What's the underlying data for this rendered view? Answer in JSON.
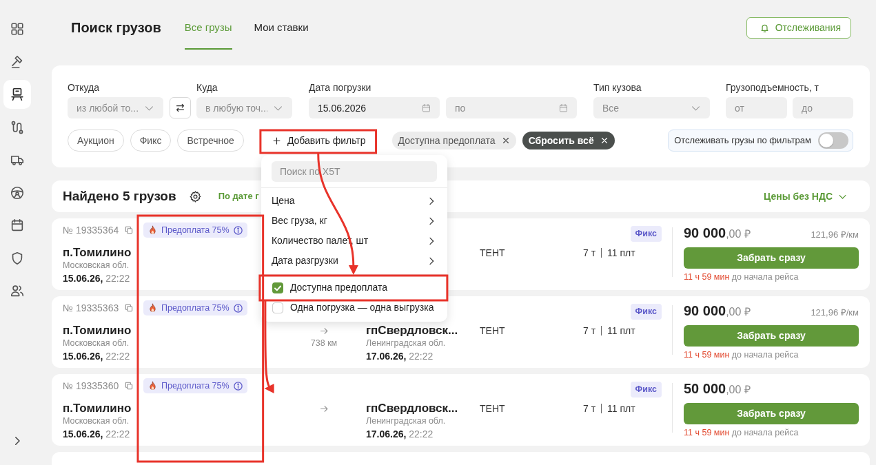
{
  "sidebar": {
    "items": [
      {
        "selected": false
      },
      {
        "selected": false
      },
      {
        "selected": true
      },
      {
        "selected": false
      },
      {
        "selected": false
      },
      {
        "selected": false
      },
      {
        "selected": false
      },
      {
        "selected": false
      },
      {
        "selected": false
      }
    ]
  },
  "header": {
    "title": "Поиск грузов",
    "tabs": [
      {
        "label": "Все грузы",
        "selected": true
      },
      {
        "label": "Мои ставки",
        "selected": false
      }
    ],
    "tracking_button": "Отслеживания"
  },
  "filters": {
    "from": {
      "label": "Откуда",
      "placeholder": "из любой то..."
    },
    "to": {
      "label": "Куда",
      "placeholder": "в любую точ..."
    },
    "loading_date": {
      "label": "Дата погрузки",
      "value": "15.06.2026",
      "to_placeholder": "по"
    },
    "body_type": {
      "label": "Тип кузова",
      "placeholder": "Все"
    },
    "capacity": {
      "label": "Грузоподъемность, т",
      "min_placeholder": "от",
      "max_placeholder": "до"
    },
    "trade_types": [
      {
        "label": "Аукцион",
        "selected": false
      },
      {
        "label": "Фикс",
        "selected": false
      },
      {
        "label": "Встречное",
        "selected": false
      }
    ],
    "add_filter": {
      "label": "Добавить фильтр",
      "highlighted": true,
      "expanded": true,
      "menu": {
        "search_placeholder": "Поиск по X5T",
        "items": [
          {
            "kind": "submenu",
            "label": "Цена",
            "highlighted": false
          },
          {
            "kind": "submenu",
            "label": "Вес груза, кг",
            "highlighted": false
          },
          {
            "kind": "submenu",
            "label": "Количество палет, шт",
            "highlighted": false
          },
          {
            "kind": "submenu",
            "label": "Дата разгрузки",
            "highlighted": false
          },
          {
            "kind": "checkbox",
            "label": "Доступна предоплата",
            "checked": true,
            "highlighted": true
          },
          {
            "kind": "checkbox",
            "label": "Одна погрузка — одна выгрузка",
            "checked": false,
            "highlighted": false
          }
        ]
      }
    },
    "applied": [
      {
        "kind": "filter",
        "label": "Доступна предоплата"
      },
      {
        "kind": "reset",
        "label": "Сбросить всё"
      }
    ],
    "track_toggle": {
      "label": "Отслеживать грузы по фильтрам",
      "on": false
    }
  },
  "results": {
    "title": "Найдено 5 грузов",
    "sort": "По дате г",
    "price_mode": "Цены без НДС",
    "badge_column_highlighted": true,
    "cards": [
      {
        "number": "№ 19335364",
        "badge": "Предоплата 75%",
        "origin": {
          "city": "п.Томилино",
          "region": "Московская обл.",
          "date": "15.06.26,",
          "time": "22:22"
        },
        "body_type": "ТЕНТ",
        "weight": "7 т",
        "pallets": "11 плт",
        "price_type": "Фикс",
        "price": "**90 000**,00 ₽",
        "per_km": "121,96 ₽/км",
        "action": "Забрать сразу",
        "countdown": "11 ч 59 мин",
        "countdown_note": "до начала рейса"
      },
      {
        "number": "№ 19335363",
        "badge": "Предоплата 75%",
        "origin": {
          "city": "п.Томилино",
          "region": "Московская обл.",
          "date": "15.06.26,",
          "time": "22:22"
        },
        "distance": "738 км",
        "destination": {
          "city": "гпСвердловск...",
          "region": "Ленинградская обл.",
          "date": "17.06.26,",
          "time": "22:22"
        },
        "body_type": "ТЕНТ",
        "weight": "7 т",
        "pallets": "11 плт",
        "price_type": "Фикс",
        "price": "**90 000**,00 ₽",
        "per_km": "121,96 ₽/км",
        "action": "Забрать сразу",
        "countdown": "11 ч 59 мин",
        "countdown_note": "до начала рейса"
      },
      {
        "number": "№ 19335360",
        "badge": "Предоплата 75%",
        "origin": {
          "city": "п.Томилино",
          "region": "Московская обл.",
          "date": "15.06.26,",
          "time": "22:22"
        },
        "destination": {
          "city": "гпСвердловск...",
          "region": "Ленинградская обл.",
          "date": "17.06.26,",
          "time": "22:22"
        },
        "body_type": "ТЕНТ",
        "weight": "7 т",
        "pallets": "11 плт",
        "price_type": "Фикс",
        "price": "**50 000**,00 ₽",
        "action": "Забрать сразу",
        "countdown": "11 ч 59 мин",
        "countdown_note": "до начала рейса"
      }
    ],
    "next_card_cut": true
  }
}
